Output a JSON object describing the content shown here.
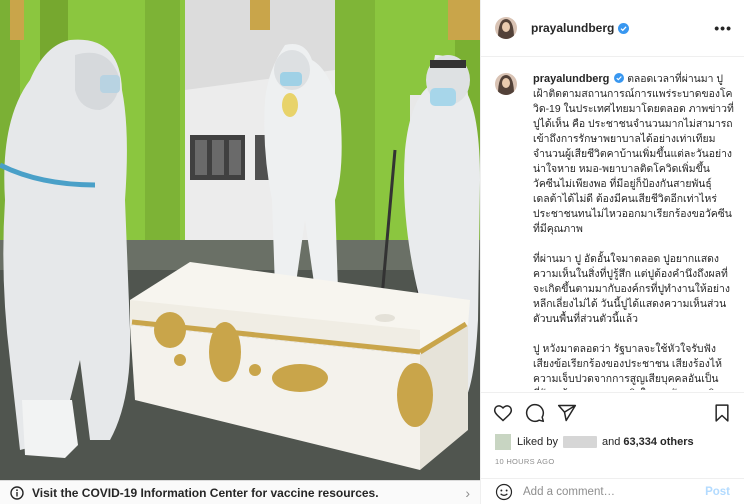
{
  "post": {
    "username": "prayalundberg",
    "more_label": "•••",
    "caption_paragraphs": [
      "ตลอดเวลาที่ผ่านมา ปูเฝ้าติดตามสถานการณ์การแพร่ระบาดของโควิด-19 ในประเทศไทยมาโดยตลอด ภาพข่าวที่ปูได้เห็น คือ ประชาชนจำนวนมากไม่สามารถเข้าถึงการรักษาพยาบาลได้อย่างเท่าเทียม จำนวนผู้เสียชีวิตคาบ้านเพิ่มขึ้นแต่ละวันอย่างน่าใจหาย หมอ-พยาบาลติดโควิดเพิ่มขึ้น วัคซีนไม่เพียงพอ ที่มีอยู่ก็ป้องกันสายพันธุ์เดลต้าได้ไม่ดี ต้องมีคนเสียชีวิตอีกเท่าไหร่ ประชาชนทนไม่ไหวออกมาเรียกร้องขอวัคซีนที่มีคุณภาพ",
      "ที่ผ่านมา ปู อัดอั้นใจมาตลอด ปูอยากแสดงความเห็นในสิ่งที่ปูรู้สึก แต่ปูต้องคำนึงถึงผลที่จะเกิดขึ้นตามมากับองค์กรที่ปูทำงานให้อย่างหลีกเลี่ยงไม่ได้ วันนี้ปูได้แสดงความเห็นส่วนตัวบนพื้นที่ส่วนตัวนี้แล้ว",
      "ปู หวังมาตลอดว่า รัฐบาลจะใช้หัวใจรับฟังเสียงข้อเรียกร้องของประชาชน เสียงร้องไห้ความเจ็บปวดจากการสูญเสียบุคคลอันเป็นที่รัก แล้วแสดงความจริงใจยอมรับความผิดพลาด ออกใบประกาศแสดงความรับผิดชอบ"
    ],
    "likes_prefix": "Liked by",
    "likes_connector": "and",
    "likes_count": "63,334 others",
    "time_ago": "10 HOURS AGO",
    "comment_placeholder": "Add a comment…",
    "post_label": "Post"
  },
  "banner": {
    "text": "Visit the COVID-19 Information Center for vaccine resources.",
    "arrow": "›"
  },
  "icons": {
    "header": [
      "verified-badge-icon",
      "more-options-icon"
    ],
    "actions": [
      "heart-icon",
      "comment-icon",
      "share-icon",
      "save-icon"
    ],
    "comment": [
      "emoji-icon"
    ],
    "banner": [
      "info-icon",
      "chevron-right-icon"
    ]
  },
  "colors": {
    "verified": "#3897f0",
    "post_button_disabled": "#b3dbff",
    "border": "#efefef",
    "secondary_text": "#8e8e8e"
  }
}
